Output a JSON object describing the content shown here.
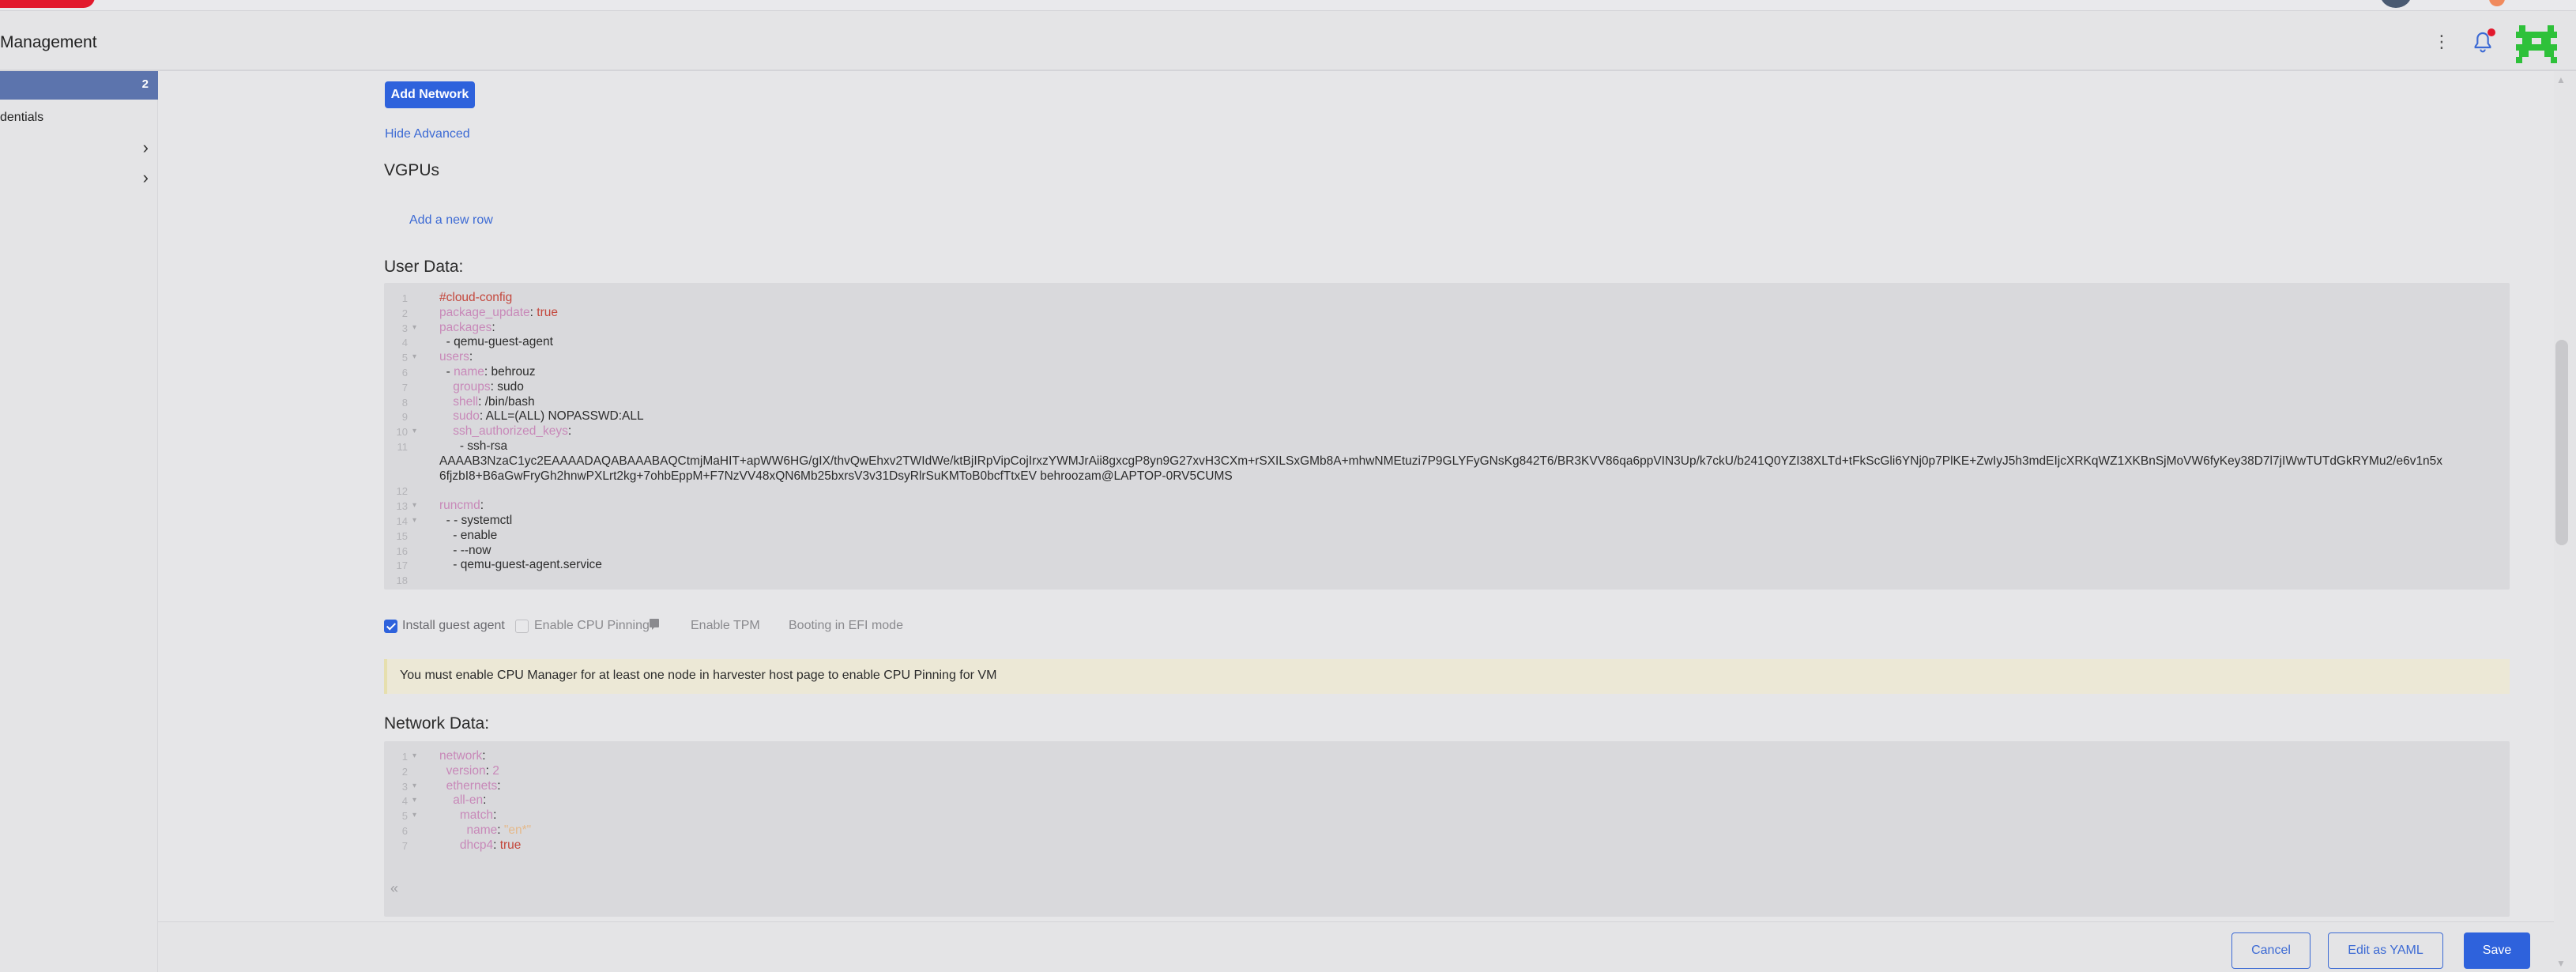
{
  "header": {
    "title": "Management"
  },
  "sidebar": {
    "active_count": "2",
    "items": [
      {
        "label": "dentials"
      },
      {
        "label": ""
      },
      {
        "label": ""
      }
    ]
  },
  "network": {
    "add_network_label": "Add Network",
    "hide_advanced_label": "Hide Advanced"
  },
  "vgpus": {
    "title": "VGPUs",
    "add_row_label": "Add a new row"
  },
  "user_data": {
    "title": "User Data:",
    "lines": [
      {
        "n": "1",
        "fold": "",
        "html": "<span class='k-comment'>#cloud-config</span>"
      },
      {
        "n": "2",
        "fold": "",
        "html": "<span class='k-key'>package_update</span>: <span class='k-bool'>true</span>"
      },
      {
        "n": "3",
        "fold": "▾",
        "html": "<span class='k-key'>packages</span>:"
      },
      {
        "n": "4",
        "fold": "",
        "html": "  - qemu-guest-agent"
      },
      {
        "n": "5",
        "fold": "▾",
        "html": "<span class='k-key'>users</span>:"
      },
      {
        "n": "6",
        "fold": "",
        "html": "  - <span class='k-key'>name</span>: behrouz"
      },
      {
        "n": "7",
        "fold": "",
        "html": "    <span class='k-key'>groups</span>: sudo"
      },
      {
        "n": "8",
        "fold": "",
        "html": "    <span class='k-key'>shell</span>: /bin/bash"
      },
      {
        "n": "9",
        "fold": "",
        "html": "    <span class='k-key'>sudo</span>: ALL=(ALL) NOPASSWD:ALL"
      },
      {
        "n": "10",
        "fold": "▾",
        "html": "    <span class='k-key'>ssh_authorized_keys</span>:"
      },
      {
        "n": "11",
        "fold": "",
        "html": "      - ssh-rsa"
      },
      {
        "n": "",
        "fold": "",
        "html": "AAAAB3NzaC1yc2EAAAADAQABAAABAQCtmjMaHIT+apWW6HG/gIX/thvQwEhxv2TWIdWe/ktBjIRpVipCojIrxzYWMJrAii8gxcgP8yn9G27xvH3CXm+rSXILSxGMb8A+mhwNMEtuzi7P9GLYFyGNsKg842T6/BR3KVV86qa6ppVIN3Up/k7ckU/b241Q0YZI38XLTd+tFkScGli6YNj0p7PlKE+ZwIyJ5h3mdEIjcXRKqWZ1XKBnSjMoVW6fyKey38D7l7jIWwTUTdGkRYMu2/e6v1n5x"
      },
      {
        "n": "",
        "fold": "",
        "html": "6fjzbI8+B6aGwFryGh2hnwPXLrt2kg+7ohbEppM+F7NzVV48xQN6Mb25bxrsV3v31DsyRlrSuKMToB0bcfTtxEV behroozam@LAPTOP-0RV5CUMS"
      },
      {
        "n": "12",
        "fold": "",
        "html": ""
      },
      {
        "n": "13",
        "fold": "▾",
        "html": "<span class='k-key'>runcmd</span>:"
      },
      {
        "n": "14",
        "fold": "▾",
        "html": "  - - systemctl"
      },
      {
        "n": "15",
        "fold": "",
        "html": "    - enable"
      },
      {
        "n": "16",
        "fold": "",
        "html": "    - --now"
      },
      {
        "n": "17",
        "fold": "",
        "html": "    - qemu-guest-agent.service"
      },
      {
        "n": "18",
        "fold": "",
        "html": ""
      }
    ]
  },
  "options": {
    "install_guest_agent": "Install guest agent",
    "enable_cpu_pinning": "Enable CPU Pinning",
    "enable_tpm": "Enable TPM",
    "efi_boot": "Booting in EFI mode"
  },
  "warning_text": "You must enable CPU Manager for at least one node in harvester host page to enable CPU Pinning for VM",
  "network_data": {
    "title": "Network Data:",
    "lines": [
      {
        "n": "1",
        "fold": "▾",
        "html": "<span class='k-key'>network</span>:"
      },
      {
        "n": "2",
        "fold": "",
        "html": "  <span class='k-key'>version</span>: <span class='k-key'>2</span>"
      },
      {
        "n": "3",
        "fold": "▾",
        "html": "  <span class='k-key'>ethernets</span>:"
      },
      {
        "n": "4",
        "fold": "▾",
        "html": "    <span class='k-key'>all-en</span>:"
      },
      {
        "n": "5",
        "fold": "▾",
        "html": "      <span class='k-key'>match</span>:"
      },
      {
        "n": "6",
        "fold": "",
        "html": "        <span class='k-key'>name</span>: <span class='k-str'>\"en*\"</span>"
      },
      {
        "n": "7",
        "fold": "",
        "html": "      <span class='k-key'>dhcp4</span>: <span class='k-bool'>true</span>"
      }
    ]
  },
  "footer": {
    "cancel_label": "Cancel",
    "yaml_label": "Edit as YAML",
    "save_label": "Save"
  },
  "colors": {
    "primary": "#2e62dc",
    "sidebar_active": "#5c74ad",
    "warning_bg": "#ece8d6"
  }
}
